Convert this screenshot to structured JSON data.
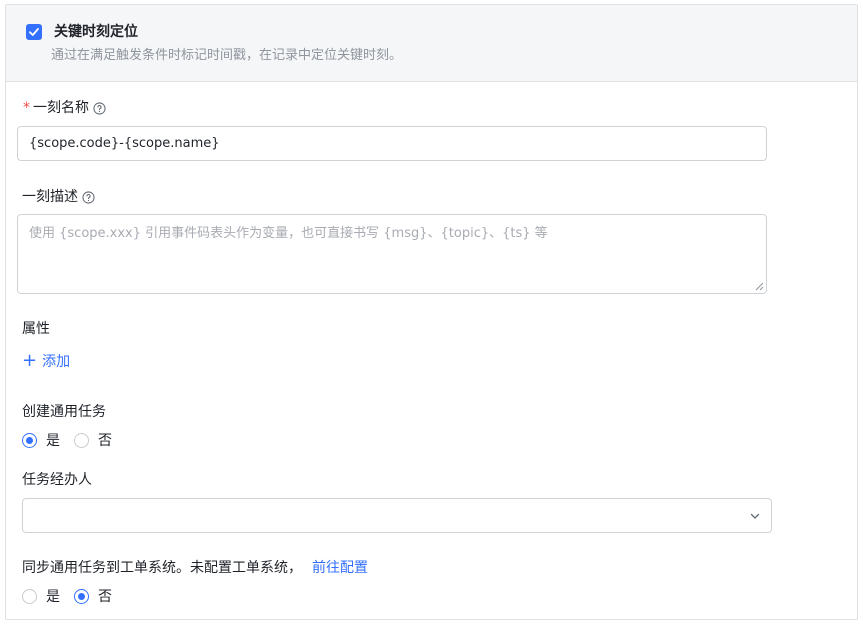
{
  "header": {
    "title": "关键时刻定位",
    "description": "通过在满足触发条件时标记时间戳，在记录中定位关键时刻。",
    "checked": true
  },
  "name_field": {
    "required_mark": "*",
    "label": "一刻名称",
    "value": "{scope.code}-{scope.name}"
  },
  "desc_field": {
    "label": "一刻描述",
    "placeholder": "使用 {scope.xxx} 引用事件码表头作为变量，也可直接书写 {msg}、{topic}、{ts} 等"
  },
  "attributes": {
    "label": "属性",
    "add_label": "添加"
  },
  "create_task": {
    "label": "创建通用任务",
    "options": [
      "是",
      "否"
    ],
    "selected": "是"
  },
  "assignee": {
    "label": "任务经办人",
    "value": ""
  },
  "sync": {
    "label": "同步通用任务到工单系统。未配置工单系统，",
    "link": "前往配置",
    "options": [
      "是",
      "否"
    ],
    "selected": "否"
  },
  "colors": {
    "accent": "#3370ff",
    "required": "#f54a45",
    "border": "#dee0e3"
  }
}
